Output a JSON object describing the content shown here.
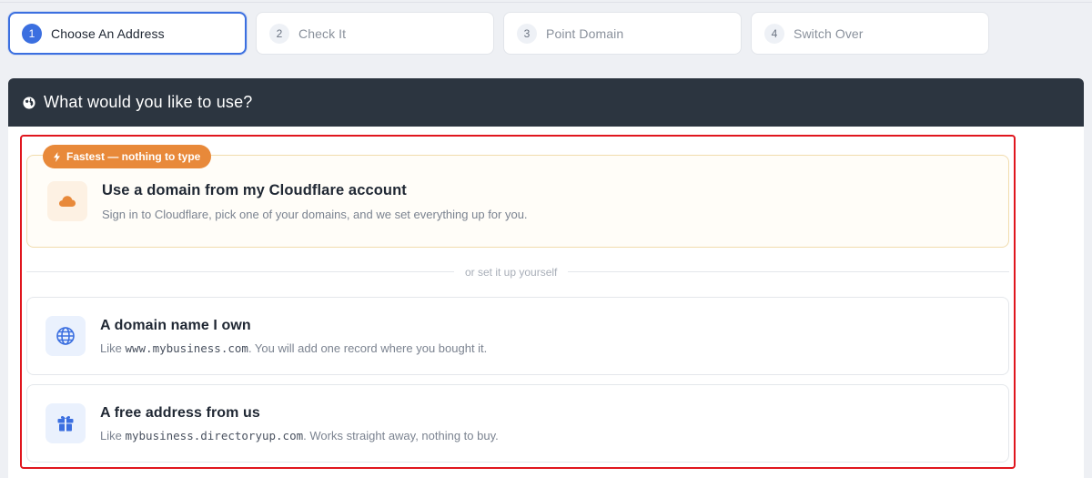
{
  "stepper": {
    "steps": [
      {
        "num": "1",
        "label": "Choose An Address"
      },
      {
        "num": "2",
        "label": "Check It"
      },
      {
        "num": "3",
        "label": "Point Domain"
      },
      {
        "num": "4",
        "label": "Switch Over"
      }
    ],
    "active_step": 1
  },
  "panel": {
    "title": "What would you like to use?",
    "header_icon": "globe-icon"
  },
  "featured_option": {
    "badge": "Fastest — nothing to type",
    "badge_icon": "bolt-icon",
    "icon": "cloud-icon",
    "title": "Use a domain from my Cloudflare account",
    "description": "Sign in to Cloudflare, pick one of your domains, and we set everything up for you."
  },
  "divider_text": "or set it up yourself",
  "options": [
    {
      "icon": "globe-icon",
      "title": "A domain name I own",
      "desc_prefix": "Like ",
      "desc_code": "www.mybusiness.com",
      "desc_suffix": ". You will add one record where you bought it."
    },
    {
      "icon": "gift-icon",
      "title": "A free address from us",
      "desc_prefix": "Like ",
      "desc_code": "mybusiness.directoryup.com",
      "desc_suffix": ". Works straight away, nothing to buy."
    }
  ],
  "colors": {
    "accent": "#3b6fe0",
    "header_bg": "#2c3540",
    "badge_bg": "#e8893a",
    "highlight": "#e0161e"
  }
}
